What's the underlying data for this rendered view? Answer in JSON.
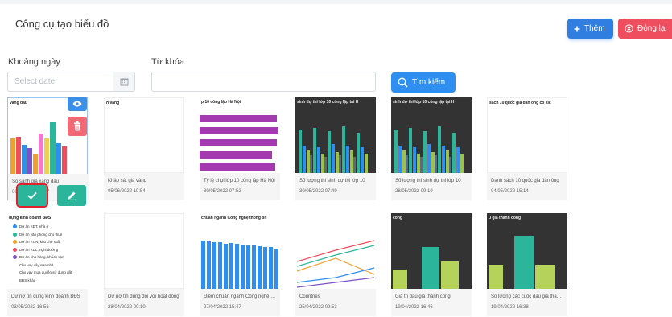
{
  "page": {
    "title": "Công cụ tạo biểu đồ",
    "add_label": "Thêm",
    "close_label": "Đóng lại"
  },
  "filters": {
    "date_label": "Khoảng ngày",
    "date_placeholder": "Select date",
    "keyword_label": "Từ khóa",
    "keyword_value": "",
    "search_label": "Tìm kiếm"
  },
  "colors": {
    "primary": "#2f7ee0",
    "danger": "#ee4e5d",
    "teal": "#2bb59a"
  },
  "cards": [
    {
      "thumb_title": "vàng dầu",
      "name": "So sánh giá xăng dầu",
      "date": "06/06/2022 11:37"
    },
    {
      "thumb_title": "h vàng",
      "name": "Khảo sát giá vàng",
      "date": "05/06/2022 19:54"
    },
    {
      "thumb_title": "p 10 công lập Hà Nội",
      "name": "Tỷ lệ chọi lớp 10 công lập Hà Nội",
      "date": "30/05/2022 07:52"
    },
    {
      "thumb_title": "sinh dự thi lớp 10 công lập tại H",
      "name": "Số lượng thí sinh dự thi lớp 10",
      "date": "30/05/2022 07:49"
    },
    {
      "thumb_title": "sinh dự thi lớp 10 công lập tại H",
      "name": "Số lượng thí sinh dự thi lớp 10",
      "date": "28/05/2022 09:19"
    },
    {
      "thumb_title": "sách 10 quốc gia dân ông có kic",
      "name": "Danh sách 10 quốc gia dân ông",
      "date": "04/05/2022 15:14"
    },
    {
      "thumb_title": "dụng kinh doanh BĐS",
      "name": "Dư nợ tín dụng kinh doanh BĐS",
      "date": "03/05/2022 16:56"
    },
    {
      "thumb_title": "",
      "name": "Dư nợ tín dụng đối với hoạt động",
      "date": "28/04/2022 00:10"
    },
    {
      "thumb_title": "chuẩn ngành Công nghệ thông tin",
      "name": "Điểm chuẩn ngành Công nghệ thông tin",
      "date": "27/04/2022 15:47"
    },
    {
      "thumb_title": "",
      "name": "Countries",
      "date": "25/04/2022 09:53"
    },
    {
      "thumb_title": "công",
      "name": "Giá trị đấu giá thành công",
      "date": "19/04/2022 16:46"
    },
    {
      "thumb_title": "u giá thành công",
      "name": "Số lượng các cuộc đấu giá thành công",
      "date": "19/04/2022 16:38"
    }
  ],
  "legend_items": [
    {
      "label": "Dự án KĐT, nhà ở",
      "color": "#2f8ff0"
    },
    {
      "label": "Dự án văn phòng cho thuê",
      "color": "#2bb59a"
    },
    {
      "label": "Dự án KCN, khu chế xuất",
      "color": "#f0a030"
    },
    {
      "label": "Dự án KDL, nghỉ dưỡng",
      "color": "#ee4e5d"
    },
    {
      "label": "Dự án nhà hàng, khách sạn",
      "color": "#7b52c7"
    },
    {
      "label": "Cho vay xây sửa nhà",
      "color": ""
    },
    {
      "label": "Cho vay mua quyền sử dụng đất",
      "color": ""
    },
    {
      "label": "BĐS khác",
      "color": ""
    }
  ],
  "icons": [
    "plus-icon",
    "close-circle-icon",
    "calendar-icon",
    "search-icon",
    "eye-icon",
    "trash-icon",
    "check-icon",
    "edit-icon"
  ]
}
